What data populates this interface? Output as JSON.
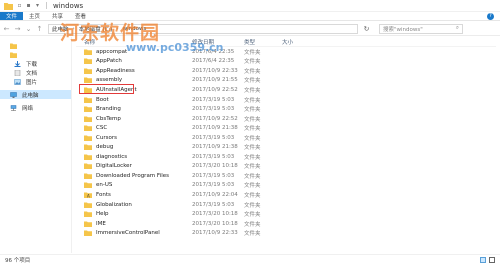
{
  "window": {
    "title": "windows",
    "accent": "#1979ca"
  },
  "ribbon": {
    "tabs": [
      "文件",
      "主页",
      "共享",
      "查看"
    ]
  },
  "address": {
    "crumbs": [
      "此电脑",
      "本地磁盘 (C:)",
      "windows"
    ]
  },
  "search": {
    "placeholder": "搜索\"windows\""
  },
  "sidebar": {
    "items": [
      {
        "label": "",
        "icon": "folder-icon",
        "selected": false
      },
      {
        "label": "",
        "icon": "folder-icon",
        "selected": false
      },
      {
        "label": "下载",
        "icon": "download-icon",
        "selected": false
      },
      {
        "label": "文档",
        "icon": "document-icon",
        "selected": false
      },
      {
        "label": "图片",
        "icon": "picture-icon",
        "selected": false
      },
      {
        "label": "此电脑",
        "icon": "computer-icon",
        "selected": true
      },
      {
        "label": "网络",
        "icon": "network-icon",
        "selected": false
      }
    ]
  },
  "columns": {
    "name": "名称",
    "date": "修改日期",
    "type": "类型",
    "size": "大小"
  },
  "files": [
    {
      "name": "appcompat",
      "date": "2017/6/4 22:35",
      "type": "文件夹"
    },
    {
      "name": "AppPatch",
      "date": "2017/6/4 22:35",
      "type": "文件夹"
    },
    {
      "name": "AppReadiness",
      "date": "2017/10/9 22:33",
      "type": "文件夹"
    },
    {
      "name": "assembly",
      "date": "2017/10/9 21:55",
      "type": "文件夹"
    },
    {
      "name": "AUInstallAgent",
      "date": "2017/10/9 22:52",
      "type": "文件夹"
    },
    {
      "name": "Boot",
      "date": "2017/3/19 5:03",
      "type": "文件夹"
    },
    {
      "name": "Branding",
      "date": "2017/3/19 5:03",
      "type": "文件夹"
    },
    {
      "name": "CbsTemp",
      "date": "2017/10/9 22:52",
      "type": "文件夹"
    },
    {
      "name": "CSC",
      "date": "2017/10/9 21:38",
      "type": "文件夹"
    },
    {
      "name": "Cursors",
      "date": "2017/3/19 5:03",
      "type": "文件夹"
    },
    {
      "name": "debug",
      "date": "2017/10/9 21:38",
      "type": "文件夹"
    },
    {
      "name": "diagnostics",
      "date": "2017/3/19 5:03",
      "type": "文件夹"
    },
    {
      "name": "DigitalLocker",
      "date": "2017/3/20 10:18",
      "type": "文件夹"
    },
    {
      "name": "Downloaded Program Files",
      "date": "2017/3/19 5:03",
      "type": "文件夹"
    },
    {
      "name": "en-US",
      "date": "2017/3/19 5:03",
      "type": "文件夹"
    },
    {
      "name": "Fonts",
      "date": "2017/10/9 22:04",
      "type": "文件夹"
    },
    {
      "name": "Globalization",
      "date": "2017/3/19 5:03",
      "type": "文件夹"
    },
    {
      "name": "Help",
      "date": "2017/3/20 10:18",
      "type": "文件夹"
    },
    {
      "name": "IME",
      "date": "2017/3/20 10:18",
      "type": "文件夹"
    },
    {
      "name": "ImmersiveControlPanel",
      "date": "2017/10/9 22:33",
      "type": "文件夹"
    }
  ],
  "highlighted_index": 4,
  "status": {
    "count": "96 个项目"
  },
  "watermark": {
    "brand": "河东软件园",
    "url": "www.pc0359.cn"
  }
}
